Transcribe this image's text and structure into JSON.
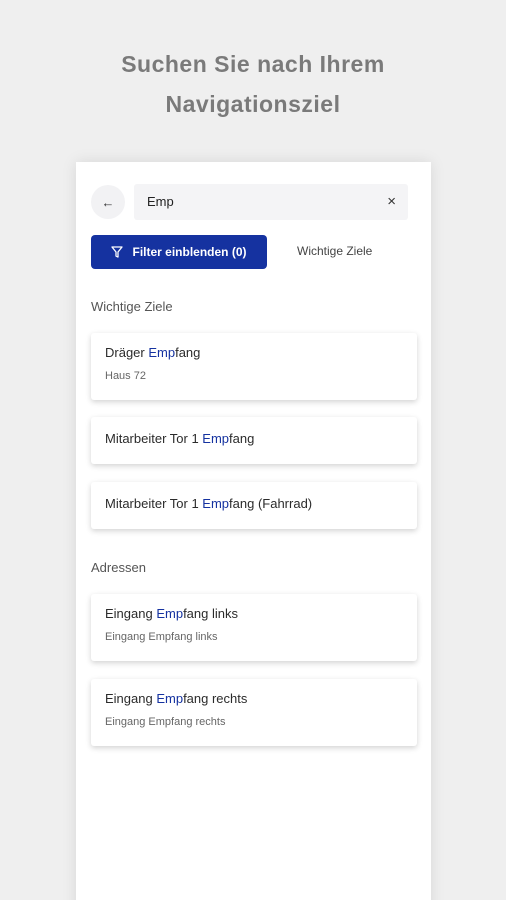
{
  "headline": {
    "line1": "Suchen Sie nach Ihrem",
    "line2": "Navigationsziel"
  },
  "search": {
    "value": "Emp"
  },
  "filter_button": {
    "label": "Filter einblenden (0)"
  },
  "tab_important": {
    "label": "Wichtige Ziele"
  },
  "sections": {
    "important": {
      "label": "Wichtige Ziele",
      "items": [
        {
          "pre": "Dräger ",
          "hl": "Emp",
          "post": "fang",
          "sub": "Haus 72"
        },
        {
          "pre": "Mitarbeiter Tor 1 ",
          "hl": "Emp",
          "post": "fang",
          "sub": ""
        },
        {
          "pre": "Mitarbeiter Tor 1 ",
          "hl": "Emp",
          "post": "fang (Fahrrad)",
          "sub": ""
        }
      ]
    },
    "addresses": {
      "label": "Adressen",
      "items": [
        {
          "pre": "Eingang ",
          "hl": "Emp",
          "post": "fang links",
          "sub": "Eingang Empfang links"
        },
        {
          "pre": "Eingang ",
          "hl": "Emp",
          "post": "fang rechts",
          "sub": "Eingang Empfang rechts"
        }
      ]
    }
  },
  "colors": {
    "accent": "#1532a0",
    "background": "#efefef"
  }
}
